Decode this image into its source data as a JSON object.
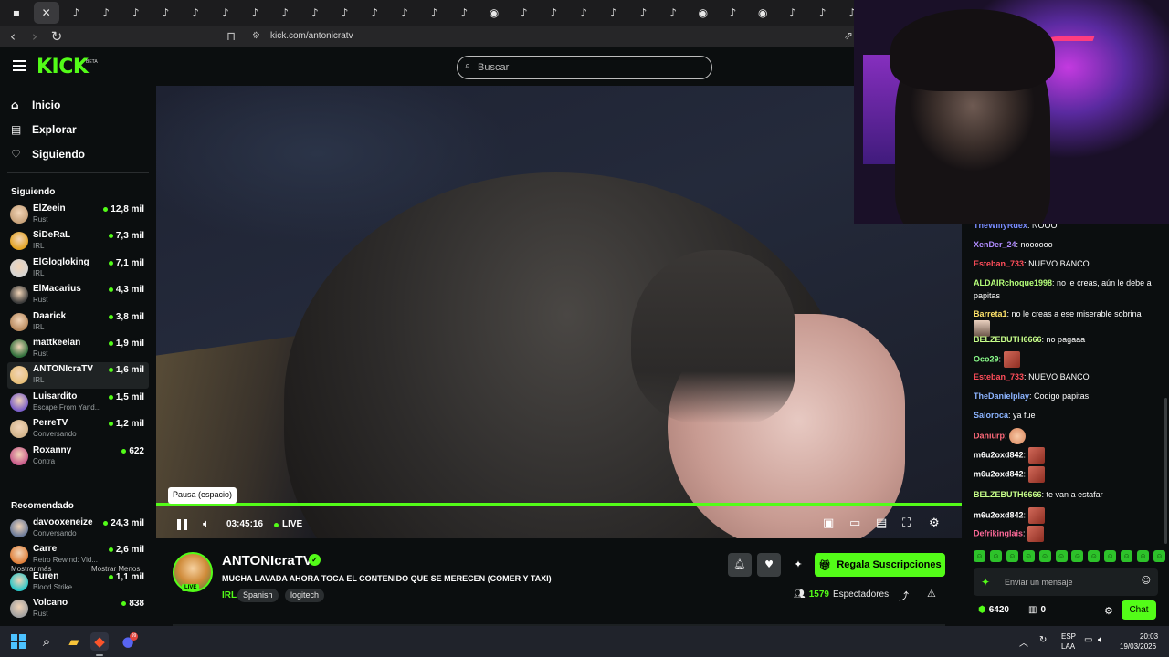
{
  "browser": {
    "url": "kick.com/antonicratv",
    "tabs": [
      {
        "icon": "app-icon",
        "glyph": "▪",
        "active": false
      },
      {
        "icon": "close-icon",
        "glyph": "✕",
        "active": true
      },
      {
        "icon": "tiktok-icon",
        "glyph": "♪"
      },
      {
        "icon": "tiktok-icon",
        "glyph": "♪"
      },
      {
        "icon": "tiktok-icon",
        "glyph": "♪"
      },
      {
        "icon": "tiktok-icon",
        "glyph": "♪"
      },
      {
        "icon": "tiktok-icon",
        "glyph": "♪"
      },
      {
        "icon": "tiktok-icon",
        "glyph": "♪"
      },
      {
        "icon": "tiktok-icon",
        "glyph": "♪"
      },
      {
        "icon": "tiktok-icon",
        "glyph": "♪"
      },
      {
        "icon": "tiktok-icon",
        "glyph": "♪"
      },
      {
        "icon": "tiktok-icon",
        "glyph": "♪"
      },
      {
        "icon": "tiktok-icon",
        "glyph": "♪"
      },
      {
        "icon": "tiktok-icon",
        "glyph": "♪"
      },
      {
        "icon": "tiktok-icon",
        "glyph": "♪"
      },
      {
        "icon": "tiktok-icon",
        "glyph": "♪"
      },
      {
        "icon": "globe-icon",
        "glyph": "◉"
      },
      {
        "icon": "tiktok-icon",
        "glyph": "♪"
      },
      {
        "icon": "tiktok-icon",
        "glyph": "♪"
      },
      {
        "icon": "tiktok-icon",
        "glyph": "♪"
      },
      {
        "icon": "tiktok-icon",
        "glyph": "♪"
      },
      {
        "icon": "tiktok-icon",
        "glyph": "♪"
      },
      {
        "icon": "tiktok-icon",
        "glyph": "♪"
      },
      {
        "icon": "globe-icon",
        "glyph": "◉"
      },
      {
        "icon": "tiktok-icon",
        "glyph": "♪"
      },
      {
        "icon": "globe-icon",
        "glyph": "◉"
      },
      {
        "icon": "tiktok-icon",
        "glyph": "♪"
      },
      {
        "icon": "tiktok-icon",
        "glyph": "♪"
      },
      {
        "icon": "tiktok-icon",
        "glyph": "♪"
      }
    ]
  },
  "header": {
    "logo": "KICK",
    "beta": "BETA",
    "search_placeholder": "Buscar"
  },
  "sidebar": {
    "nav": [
      {
        "label": "Inicio",
        "icon": "home-icon",
        "glyph": "⌂"
      },
      {
        "label": "Explorar",
        "icon": "explore-icon",
        "glyph": "▤"
      },
      {
        "label": "Siguiendo",
        "icon": "heart-icon",
        "glyph": "♡"
      }
    ],
    "following_title": "Siguiendo",
    "following": [
      {
        "name": "ElZeein",
        "game": "Rust",
        "viewers": "12,8 mil",
        "color": "#c8a27a"
      },
      {
        "name": "SiDeRaL",
        "game": "IRL",
        "viewers": "7,3 mil",
        "color": "#e3a322"
      },
      {
        "name": "ElGlogloking",
        "game": "IRL",
        "viewers": "7,1 mil",
        "color": "#d4d4d4"
      },
      {
        "name": "ElMacarius",
        "game": "Rust",
        "viewers": "4,3 mil",
        "color": "#3a3a3a"
      },
      {
        "name": "Daarick",
        "game": "IRL",
        "viewers": "3,8 mil",
        "color": "#b88a5e"
      },
      {
        "name": "mattkeelan",
        "game": "Rust",
        "viewers": "1,9 mil",
        "color": "#2e6e3a"
      },
      {
        "name": "ANTONIcraTV",
        "game": "IRL",
        "viewers": "1,6 mil",
        "color": "#e8c07a"
      },
      {
        "name": "Luisardito",
        "game": "Escape From Yand...",
        "viewers": "1,5 mil",
        "color": "#7a5ec8"
      },
      {
        "name": "PerreTV",
        "game": "Conversando",
        "viewers": "1,2 mil",
        "color": "#d2b48c"
      },
      {
        "name": "Roxanny",
        "game": "Contra",
        "viewers": "622",
        "color": "#c85a8a"
      }
    ],
    "show_more": "Mostrar más",
    "show_less": "Mostrar Menos",
    "recommended_title": "Recomendado",
    "recommended": [
      {
        "name": "davooxeneize",
        "game": "Conversando",
        "viewers": "24,3 mil",
        "color": "#6a7a9a"
      },
      {
        "name": "Carre",
        "game": "Retro Rewind: Vid...",
        "viewers": "2,6 mil",
        "color": "#e0803a"
      },
      {
        "name": "Euren",
        "game": "Blood Strike",
        "viewers": "1,1 mil",
        "color": "#2ac8c8"
      },
      {
        "name": "Volcano",
        "game": "Rust",
        "viewers": "838",
        "color": "#a0a0a0"
      }
    ]
  },
  "player": {
    "tooltip": "Pausa (espacio)",
    "time": "03:45:16",
    "live": "LIVE",
    "progress": 1.0
  },
  "stream": {
    "avatar_badge": "LIVE",
    "name": "ANTONIcraTV",
    "title": "MUCHA LAVADA AHORA TOCA EL CONTENIDO QUE SE MERECEN (COMER Y TAXI)",
    "category": "IRL",
    "tags": [
      "Spanish",
      "logitech"
    ],
    "subs_button": "Regala Suscripciones",
    "viewers": "1579",
    "viewers_label": "Espectadores"
  },
  "chat": {
    "messages": [
      {
        "user": "TheWillyRdex",
        "color": "#7a8cff",
        "text": "NOOO"
      },
      {
        "user": "XenDer_24",
        "color": "#b18cff",
        "text": "noooooo"
      },
      {
        "user": "Esteban_733",
        "color": "#ff4d5a",
        "text": "NUEVO BANCO"
      },
      {
        "user": "ALDAIRchoque1998",
        "color": "#b6ff7a",
        "text": "no le creas, aún le debe a papitas"
      },
      {
        "user": "Barreta1",
        "color": "#ffe36a",
        "text": "no le creas a ese miserable sobrina"
      },
      {
        "user": "BELZEBUTH6666",
        "color": "#c8ff8a",
        "text": "no pagaaa"
      },
      {
        "user": "Oco29",
        "color": "#8cff8c",
        "text": ""
      },
      {
        "user": "Esteban_733",
        "color": "#ff4d5a",
        "text": "NUEVO BANCO"
      },
      {
        "user": "TheDanielplay",
        "color": "#8cb4ff",
        "text": "Codigo papitas"
      },
      {
        "user": "Saloroca",
        "color": "#8cb4ff",
        "text": "ya fue"
      },
      {
        "user": "Daniurp",
        "color": "#ff6a7a",
        "text": ""
      },
      {
        "user": "m6u2oxd842",
        "color": "#ffffff",
        "text": ""
      },
      {
        "user": "m6u2oxd842",
        "color": "#ffffff",
        "text": ""
      },
      {
        "user": "BELZEBUTH6666",
        "color": "#c8ff8a",
        "text": "te van a estafar"
      },
      {
        "user": "m6u2oxd842",
        "color": "#ffffff",
        "text": ""
      },
      {
        "user": "Defrikinglais",
        "color": "#ff6a9a",
        "text": ""
      }
    ],
    "input_placeholder": "Enviar un mensaje",
    "points": "6420",
    "store_count": "0",
    "chat_button": "Chat"
  },
  "taskbar": {
    "lang1": "ESP",
    "lang2": "LAA",
    "time": "20:03",
    "date": "19/03/2026",
    "discord_badge": "99"
  }
}
